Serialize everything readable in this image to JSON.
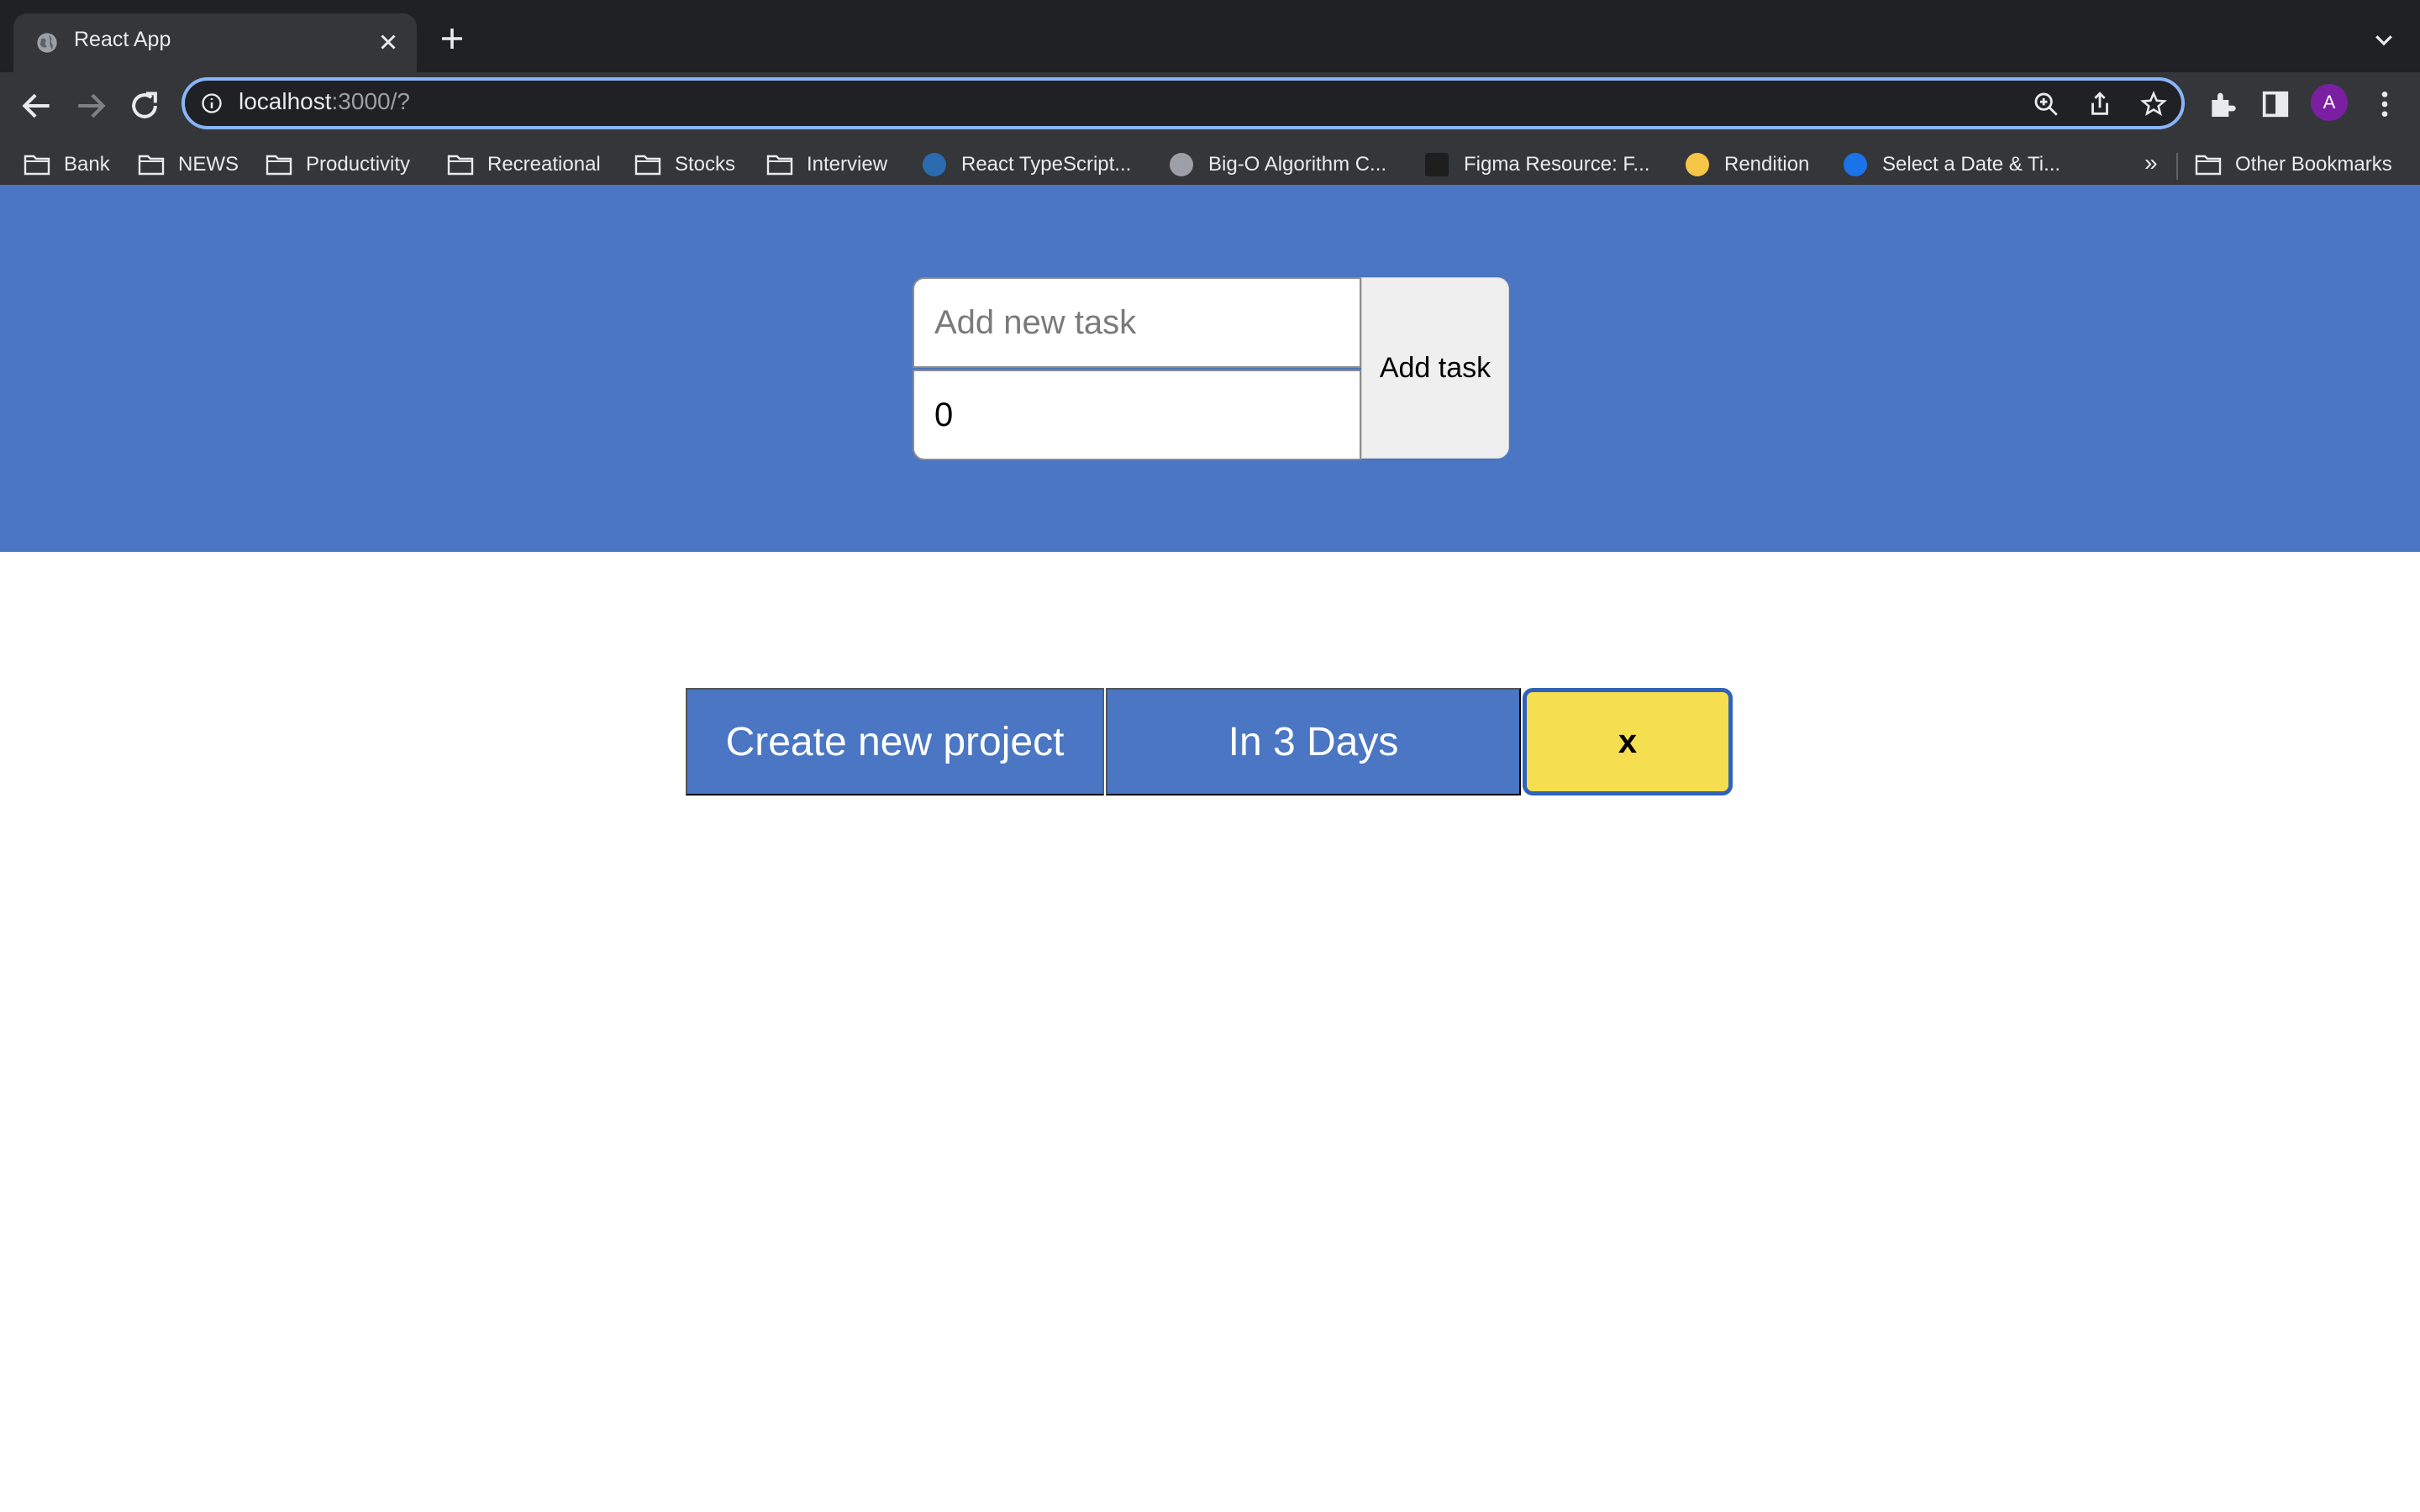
{
  "browser": {
    "tab_title": "React App",
    "url_host": "localhost",
    "url_rest": ":3000/?",
    "avatar_letter": "A",
    "bookmarks": [
      {
        "label": "Bank",
        "type": "folder"
      },
      {
        "label": "NEWS",
        "type": "folder"
      },
      {
        "label": "Productivity",
        "type": "folder"
      },
      {
        "label": "Recreational",
        "type": "folder"
      },
      {
        "label": "Stocks",
        "type": "folder"
      },
      {
        "label": "Interview",
        "type": "folder"
      },
      {
        "label": "React TypeScript...",
        "type": "link"
      },
      {
        "label": "Big-O Algorithm C...",
        "type": "link"
      },
      {
        "label": "Figma Resource: F...",
        "type": "link"
      },
      {
        "label": "Rendition",
        "type": "link"
      },
      {
        "label": "Select a Date & Ti...",
        "type": "link"
      }
    ],
    "overflow_label": "»",
    "other_bookmarks": "Other Bookmarks"
  },
  "task_form": {
    "task_placeholder": "Add new task",
    "days_value": "0",
    "add_button": "Add task"
  },
  "project": {
    "name": "Create new project",
    "due": "In 3 Days",
    "close": "x"
  },
  "colors": {
    "accent_blue": "#4a76c3",
    "close_yellow": "#f5df50",
    "chrome_dark": "#202124"
  }
}
